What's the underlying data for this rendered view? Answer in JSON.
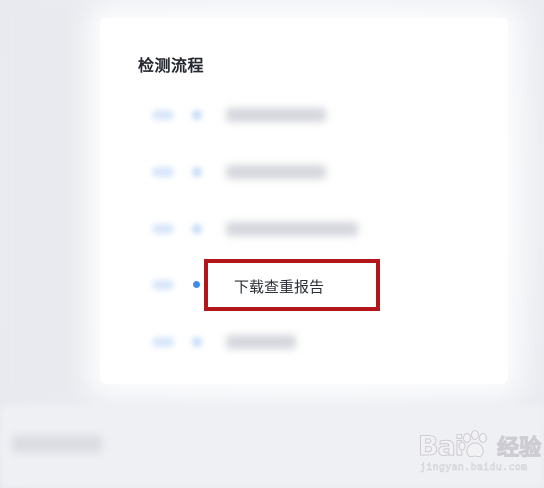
{
  "card": {
    "title": "检测流程"
  },
  "steps": [
    {
      "state": "blurred"
    },
    {
      "state": "blurred"
    },
    {
      "state": "blurred"
    },
    {
      "state": "active",
      "label": "下载查重报告"
    },
    {
      "state": "blurred"
    }
  ],
  "colors": {
    "highlight_border": "#b2161a",
    "active_dot": "#3f8bf0",
    "title_text": "#23272e"
  },
  "watermark": {
    "brand": "Bai",
    "brand_suffix": "经验",
    "url": "jingyan.baidu.com",
    "icon": "paw-icon"
  }
}
